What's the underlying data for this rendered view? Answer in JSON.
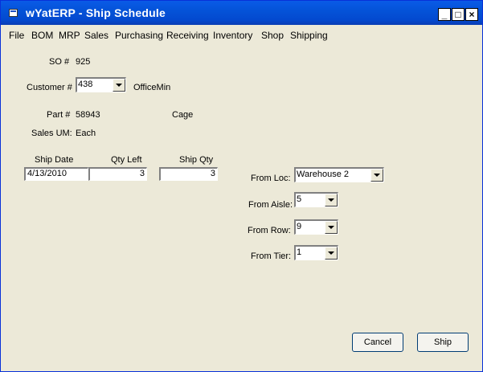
{
  "window": {
    "title": "wYatERP - Ship Schedule",
    "minimize_glyph": "_",
    "maximize_glyph": "□",
    "close_glyph": "×"
  },
  "menu": [
    "File",
    "BOM",
    "MRP",
    "Sales",
    "Purchasing",
    "Receiving",
    "Inventory",
    "Shop",
    "Shipping"
  ],
  "so": {
    "label": "SO #",
    "value": "925"
  },
  "customer": {
    "label": "Customer #",
    "value": "438",
    "name": "OfficeMin"
  },
  "part": {
    "label": "Part #",
    "value": "58943",
    "description": "Cage"
  },
  "sales_um": {
    "label": "Sales UM:",
    "value": "Each"
  },
  "grid": {
    "ship_date_header": "Ship Date",
    "qty_left_header": "Qty Left",
    "ship_qty_header": "Ship Qty",
    "ship_date": "4/13/2010",
    "qty_left": "3",
    "ship_qty": "3"
  },
  "from_loc": {
    "label": "From Loc:",
    "value": "Warehouse 2"
  },
  "from_aisle": {
    "label": "From Aisle:",
    "value": "5"
  },
  "from_row": {
    "label": "From Row:",
    "value": "9"
  },
  "from_tier": {
    "label": "From Tier:",
    "value": "1"
  },
  "buttons": {
    "cancel": "Cancel",
    "ship": "Ship"
  }
}
